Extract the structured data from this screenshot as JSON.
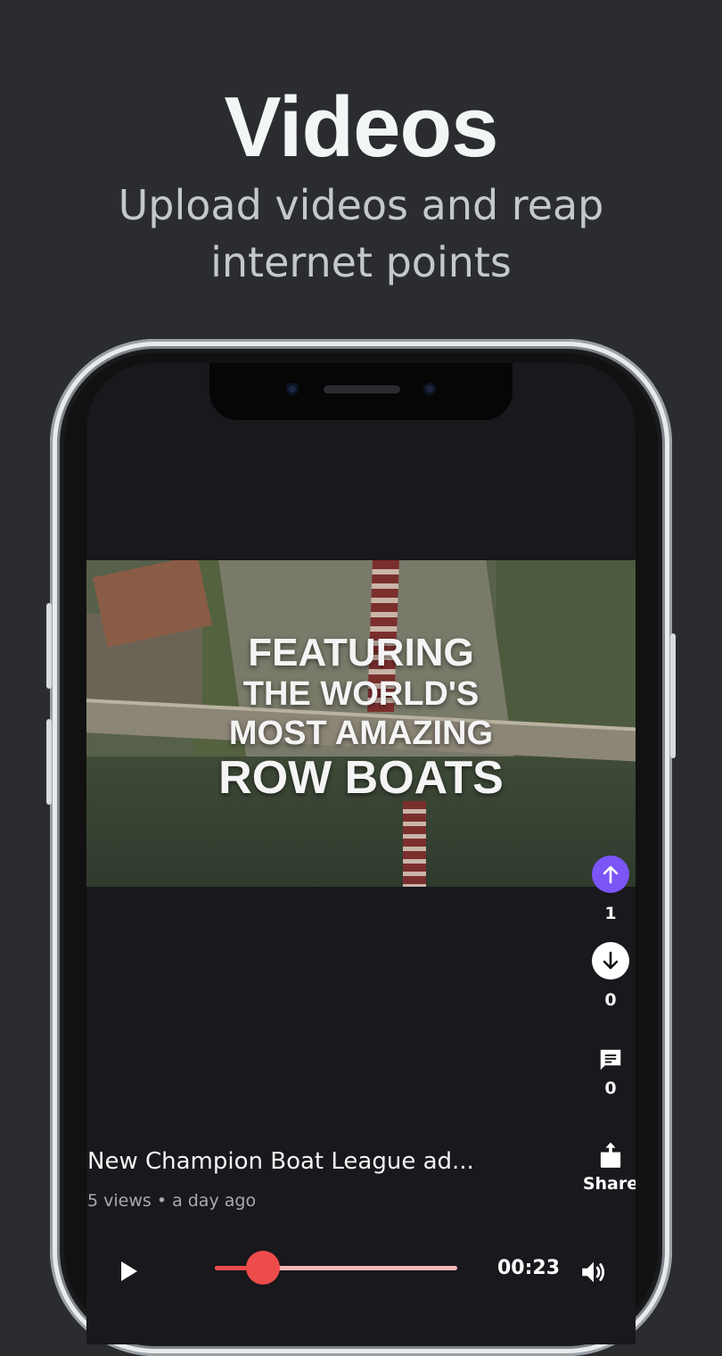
{
  "hero": {
    "title": "Videos",
    "subtitle_line1": "Upload videos and reap",
    "subtitle_line2": "internet points"
  },
  "video": {
    "overlay_line1": "FEATURING",
    "overlay_line2": "THE WORLD'S",
    "overlay_line3": "MOST AMAZING",
    "overlay_line4": "ROW BOATS",
    "title": "New Champion Boat League ad...",
    "meta": "5 views • a day ago",
    "time": "00:23",
    "progress": 0.2
  },
  "actions": {
    "upvote_count": "1",
    "downvote_count": "0",
    "comment_count": "0",
    "share_label": "Share"
  },
  "colors": {
    "background": "#2b2c30",
    "screen": "#18181d",
    "upvote": "#7b55f6",
    "seek": "#ee4b4b"
  },
  "icons": [
    "arrow-up-icon",
    "arrow-down-icon",
    "comment-icon",
    "share-icon",
    "play-icon",
    "volume-icon"
  ]
}
